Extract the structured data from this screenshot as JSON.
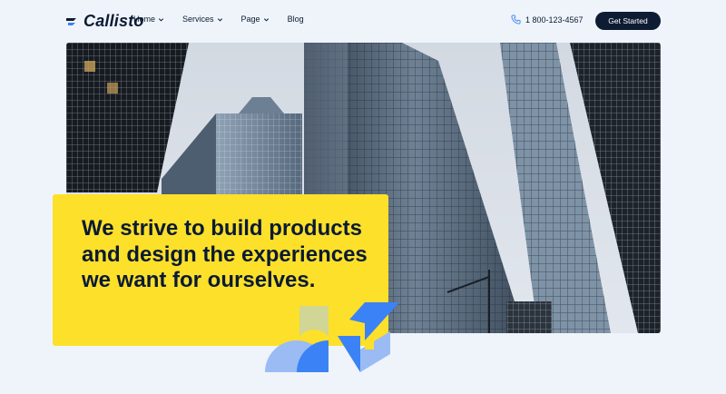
{
  "header": {
    "logo_text": "Callisto",
    "nav": [
      {
        "label": "Home",
        "dropdown": true
      },
      {
        "label": "Services",
        "dropdown": true
      },
      {
        "label": "Page",
        "dropdown": true
      },
      {
        "label": "Blog",
        "dropdown": false
      }
    ],
    "phone": "1 800-123-4567",
    "cta_label": "Get Started"
  },
  "hero": {
    "headline": "We strive to build products and design the experiences we want for ourselves."
  },
  "colors": {
    "navy": "#0d1b33",
    "yellow": "#fde02a",
    "accent_blue": "#3b82f6",
    "background": "#eff4fa"
  },
  "icons": [
    "logo-mark-icon",
    "chevron-down-icon",
    "phone-icon"
  ]
}
